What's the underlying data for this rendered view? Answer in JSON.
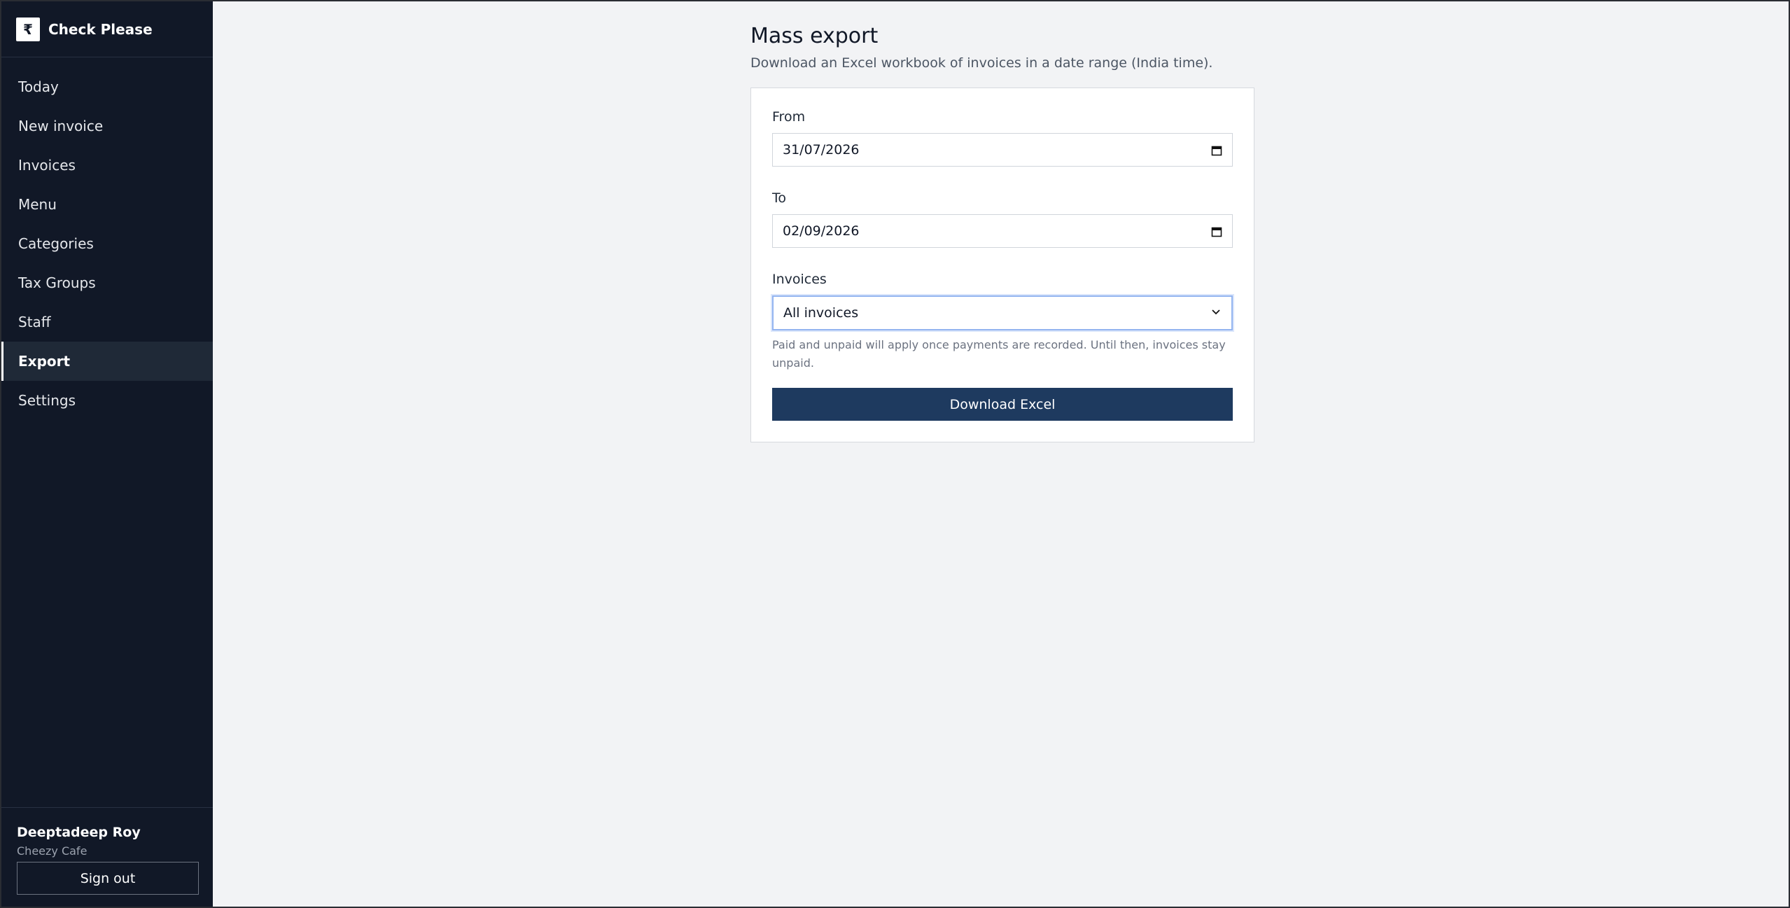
{
  "brand": {
    "logo_glyph": "₹",
    "name": "Check Please"
  },
  "nav": {
    "items": [
      {
        "label": "Today"
      },
      {
        "label": "New invoice"
      },
      {
        "label": "Invoices"
      },
      {
        "label": "Menu"
      },
      {
        "label": "Categories"
      },
      {
        "label": "Tax Groups"
      },
      {
        "label": "Staff"
      },
      {
        "label": "Export",
        "active": true
      },
      {
        "label": "Settings"
      }
    ]
  },
  "user": {
    "name": "Deeptadeep Roy",
    "org": "Cheezy Cafe",
    "signout_label": "Sign out"
  },
  "page": {
    "title": "Mass export",
    "subtitle": "Download an Excel workbook of invoices in a date range (India time)."
  },
  "form": {
    "from_label": "From",
    "from_value": "31/07/2026",
    "to_label": "To",
    "to_value": "02/09/2026",
    "invoices_label": "Invoices",
    "invoices_selected": "All invoices",
    "helper_text": "Paid and unpaid will apply once payments are recorded. Until then, invoices stay unpaid.",
    "download_label": "Download Excel"
  },
  "icons": {
    "calendar": "calendar-icon",
    "chevron": "chevron-down-icon"
  },
  "colors": {
    "sidebar_bg": "#111827",
    "accent_button": "#1e3a5f",
    "page_bg": "#f2f3f5"
  }
}
